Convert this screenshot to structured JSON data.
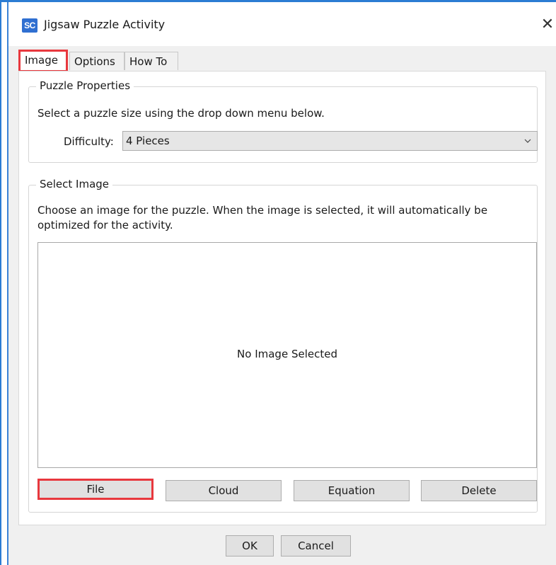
{
  "window": {
    "title": "Jigsaw Puzzle Activity",
    "icon_text": "SC",
    "close_glyph": "✕"
  },
  "tabs": [
    {
      "label": "Image",
      "active": true
    },
    {
      "label": "Options",
      "active": false
    },
    {
      "label": "How To",
      "active": false
    }
  ],
  "puzzle_properties": {
    "legend": "Puzzle Properties",
    "instruction": "Select a puzzle size using the drop down menu below.",
    "difficulty_label": "Difficulty:",
    "difficulty_value": "4 Pieces"
  },
  "select_image": {
    "legend": "Select Image",
    "instruction_line1": "Choose an image for the puzzle. When the image is selected, it will automatically be",
    "instruction_line2": "optimized for the activity.",
    "placeholder": "No Image Selected",
    "buttons": {
      "file": "File",
      "cloud": "Cloud",
      "equation": "Equation",
      "delete": "Delete"
    }
  },
  "footer": {
    "ok": "OK",
    "cancel": "Cancel"
  },
  "colors": {
    "highlight": "#e8383e",
    "accent": "#2b7cd3"
  },
  "icons": {
    "app": "sc-app-icon",
    "close": "close-icon",
    "dropdown": "chevron-down-icon"
  }
}
